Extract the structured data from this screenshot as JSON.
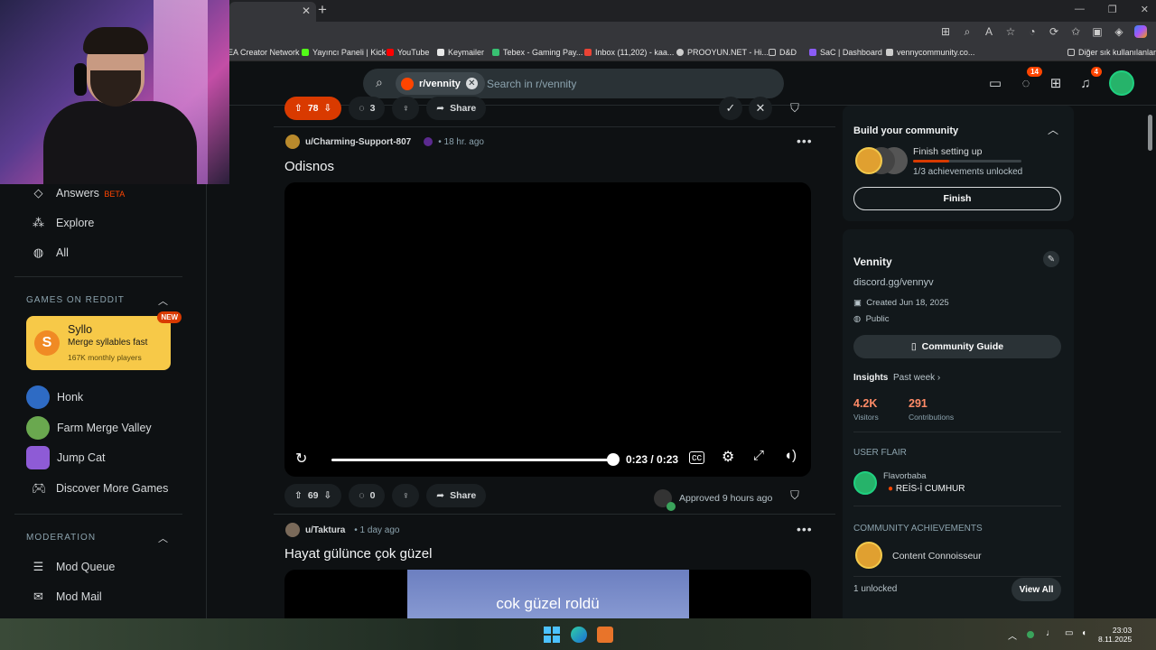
{
  "browser": {
    "tab_close": "✕",
    "new_tab": "+",
    "bookmarks": [
      {
        "label": "EA Creator Network",
        "color": "#e04a3a"
      },
      {
        "label": "Yayıncı Paneli | Kick",
        "color": "#53fc18"
      },
      {
        "label": "YouTube",
        "color": "#ff0000"
      },
      {
        "label": "Keymailer",
        "color": "#e8e8e8"
      },
      {
        "label": "Tebex - Gaming Pay...",
        "color": "#38c172"
      },
      {
        "label": "Inbox (11,202) - kaa...",
        "color": "#ea4335"
      },
      {
        "label": "PROOYUN.NET - Hi...",
        "color": "#cccccc"
      },
      {
        "label": "D&D",
        "color": "#cccccc"
      },
      {
        "label": "SaC | Dashboard",
        "color": "#8b5cf6"
      },
      {
        "label": "vennycommunity.co...",
        "color": "#cccccc"
      }
    ],
    "other_bookmarks": "Diğer sık kullanılanlar"
  },
  "header": {
    "search_chip": "r/vennity",
    "search_placeholder": "Search in r/vennity",
    "chat_badge": "14",
    "notif_badge": "4"
  },
  "sidebar": {
    "answers": "Answers",
    "answers_badge": "BETA",
    "explore": "Explore",
    "all": "All",
    "games_header": "GAMES ON REDDIT",
    "featured_game": {
      "name": "Syllo",
      "tagline": "Merge syllables fast",
      "players": "167K monthly players",
      "badge": "NEW"
    },
    "games": [
      "Honk",
      "Farm Merge Valley",
      "Jump Cat"
    ],
    "discover": "Discover More Games",
    "moderation_header": "MODERATION",
    "mod_queue": "Mod Queue",
    "mod_mail": "Mod Mail"
  },
  "feed": {
    "top_bar": {
      "votes": "78",
      "comments": "3",
      "share": "Share"
    },
    "post1": {
      "author": "u/Charming-Support-807",
      "time": "• 18 hr. ago",
      "title": "Odisnos",
      "video_time": "0:23 / 0:23",
      "progress": 1.0,
      "votes": "69",
      "comments": "0",
      "share": "Share",
      "approved": "Approved 9 hours ago"
    },
    "post2": {
      "author": "u/Taktura",
      "time": "• 1 day ago",
      "title": "Hayat gülünce çok güzel",
      "caption": "cok güzel roldü"
    }
  },
  "right": {
    "build": {
      "title": "Build your community",
      "status": "Finish setting up",
      "progress": "1/3 achievements unlocked",
      "progress_fraction": 0.33,
      "button": "Finish"
    },
    "about": {
      "name": "Vennity",
      "description": "discord.gg/vennyv",
      "created": "Created Jun 18, 2025",
      "visibility": "Public",
      "guide_button": "Community Guide",
      "insights_label": "Insights",
      "insights_range": "Past week ›",
      "visitors_value": "4.2K",
      "visitors_label": "Visitors",
      "contrib_value": "291",
      "contrib_label": "Contributions",
      "flair_header": "USER FLAIR",
      "flair_user": "Flavorbaba",
      "flair_text": "REİS-İ CUMHUR",
      "ach_header": "COMMUNITY ACHIEVEMENTS",
      "ach_name": "Content Connoisseur",
      "unlocked": "1 unlocked",
      "view_all": "View All"
    }
  },
  "taskbar": {
    "time": "23:03",
    "date": "8.11.2025"
  },
  "colors": {
    "accent": "#ff4500",
    "vote_bg": "#d93a00",
    "bg": "#0e1113"
  }
}
